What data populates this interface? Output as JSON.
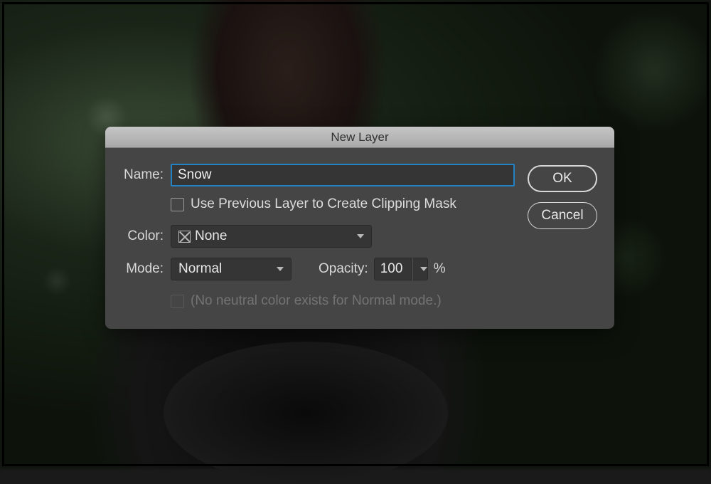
{
  "dialog": {
    "title": "New Layer",
    "name_label": "Name:",
    "name_value": "Snow",
    "clipping_mask_label": "Use Previous Layer to Create Clipping Mask",
    "clipping_mask_checked": false,
    "color_label": "Color:",
    "color_value": "None",
    "mode_label": "Mode:",
    "mode_value": "Normal",
    "opacity_label": "Opacity:",
    "opacity_value": "100",
    "opacity_unit": "%",
    "neutral_label": "(No neutral color exists for Normal mode.)",
    "neutral_enabled": false,
    "ok_label": "OK",
    "cancel_label": "Cancel"
  }
}
